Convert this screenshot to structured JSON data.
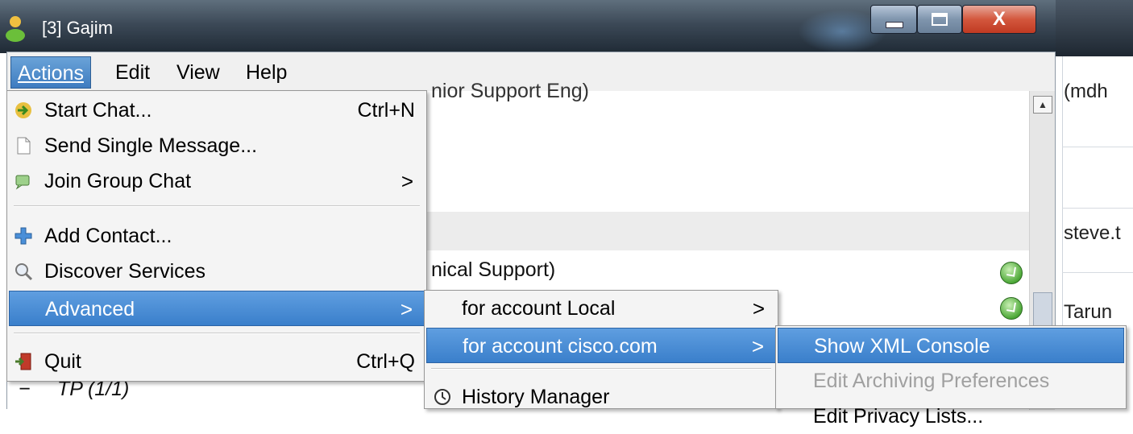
{
  "window": {
    "title": "[3]  Gajim",
    "buttons": {
      "minimize": "minimize",
      "maximize": "maximize",
      "close": "X"
    }
  },
  "menubar": [
    {
      "label": "Actions",
      "mnemonic": "A"
    },
    {
      "label": "Edit",
      "mnemonic": "E"
    },
    {
      "label": "View",
      "mnemonic": "V"
    },
    {
      "label": "Help",
      "mnemonic": "H"
    }
  ],
  "actions_menu": {
    "start_chat": {
      "label": "Start Chat...",
      "shortcut": "Ctrl+N"
    },
    "send_single_message": {
      "label": "Send Single Message..."
    },
    "join_group_chat": {
      "label": "Join Group Chat"
    },
    "add_contact": {
      "label": "Add Contact..."
    },
    "discover_services": {
      "label": "Discover Services"
    },
    "advanced": {
      "label": "Advanced"
    },
    "quit": {
      "label": "Quit",
      "shortcut": "Ctrl+Q"
    }
  },
  "advanced_submenu": {
    "account_local": "for account Local",
    "account_cisco": "for account cisco.com",
    "history_manager": "History Manager"
  },
  "account_submenu": {
    "show_xml_console": "Show XML Console",
    "edit_archiving": "Edit Archiving Preferences",
    "edit_privacy": "Edit Privacy Lists..."
  },
  "roster": {
    "partial_top": "nior Support Eng)",
    "partial_mid": "nical Support)",
    "group": "TP (1/1)",
    "group_expander": "−"
  },
  "background_window": {
    "row1": "(mdh",
    "row2": "steve.t",
    "row3": "Tarun"
  },
  "icons": {
    "start_chat": "arrow-icon",
    "send_single": "document-icon",
    "join_group": "chat-icon",
    "add_contact": "plus-icon",
    "discover": "magnifier-icon",
    "quit": "exit-door-icon",
    "history": "history-icon",
    "status": "online-status-icon"
  },
  "colors": {
    "highlight": "#3f7cc0",
    "menu_bg": "#f4f4f4",
    "disabled": "#a0a0a0"
  }
}
